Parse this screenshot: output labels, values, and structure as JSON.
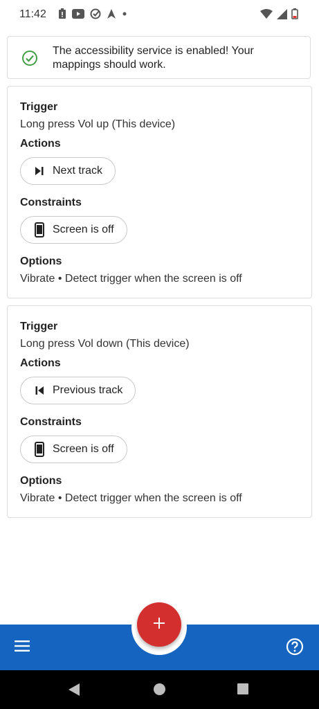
{
  "status_bar": {
    "time": "11:42",
    "icons": [
      "alert-icon",
      "youtube-icon",
      "check-icon",
      "navigation-icon",
      "dot-icon"
    ],
    "right_icons": [
      "wifi-icon",
      "signal-icon",
      "battery-low-icon"
    ]
  },
  "banner": {
    "icon": "check-circle-icon",
    "icon_color": "#43a047",
    "text": "The accessibility service is enabled! Your mappings should work."
  },
  "mappings": [
    {
      "trigger_label": "Trigger",
      "trigger_value": "Long press Vol up (This device)",
      "actions_label": "Actions",
      "action_chip": "Next track",
      "action_icon": "skip-next-icon",
      "constraints_label": "Constraints",
      "constraint_chip": "Screen is off",
      "constraint_icon": "phone-icon",
      "options_label": "Options",
      "options_value": "Vibrate • Detect trigger when the screen is off"
    },
    {
      "trigger_label": "Trigger",
      "trigger_value": "Long press Vol down (This device)",
      "actions_label": "Actions",
      "action_chip": "Previous track",
      "action_icon": "skip-previous-icon",
      "constraints_label": "Constraints",
      "constraint_chip": "Screen is off",
      "constraint_icon": "phone-icon",
      "options_label": "Options",
      "options_value": "Vibrate • Detect trigger when the screen is off"
    }
  ],
  "fab": {
    "icon": "plus-icon",
    "color": "#d32f2f"
  },
  "bottom_bar": {
    "color": "#1565c0",
    "left_icon": "menu-icon",
    "right_icon": "help-icon"
  },
  "system_nav": {
    "icons": [
      "back-icon",
      "home-icon",
      "recents-icon"
    ]
  }
}
